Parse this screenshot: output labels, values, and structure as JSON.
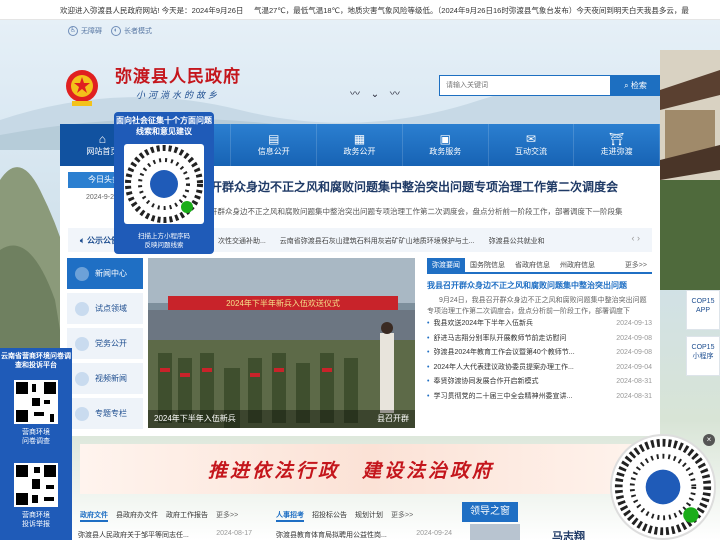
{
  "topbar": {
    "welcome": "欢迎进入弥渡县人民政府网站! 今天是：2024年9月26日",
    "ticker": "气温27℃，最低气温18℃，地质灾害气象风险等级低。（2024年9月26日16时弥渡县气象台发布）今天夜间到明天白天我县多云，最"
  },
  "accessibility": {
    "barrier_free": "无障碍",
    "elder_mode": "长者模式"
  },
  "header": {
    "site_title": "弥渡县人民政府",
    "slogan": "小河淌水的故乡",
    "search_placeholder": "请输入关键词",
    "search_button": "检索"
  },
  "nav": [
    {
      "label": "网站首页",
      "icon": "home-icon"
    },
    {
      "label": "",
      "icon": "info-icon"
    },
    {
      "label": "信息公开",
      "icon": "document-icon"
    },
    {
      "label": "政务公开",
      "icon": "government-icon"
    },
    {
      "label": "政务服务",
      "icon": "service-icon"
    },
    {
      "label": "互动交流",
      "icon": "chat-icon"
    },
    {
      "label": "走进弥渡",
      "icon": "landmark-icon"
    }
  ],
  "today": {
    "tab_label": "今日头条",
    "date": "2024-9-2"
  },
  "headline": {
    "title": "开群众身边不正之风和腐败问题集中整治突出问题专项治理工作第二次调度会",
    "summary": "开群众身边不正之风和腐败问题集中整治突出问题专项治理工作第二次调度会，盘点分析前一阶段工作，部署调度下一阶段集"
  },
  "notice": {
    "label": "公示公告",
    "items": [
      "次性交通补助...",
      "云南省弥渡县石灰山建筑石料用灰岩矿矿山地质环境保护与土...",
      "弥渡县公共就业和"
    ]
  },
  "left_menu": [
    {
      "label": "新闻中心",
      "active": true
    },
    {
      "label": "试点领域",
      "active": false
    },
    {
      "label": "党务公开",
      "active": false
    },
    {
      "label": "视频新闻",
      "active": false
    },
    {
      "label": "专题专栏",
      "active": false
    }
  ],
  "photo": {
    "banner_text": "2024年下半年新兵入伍欢送仪式",
    "caption": "2024年下半年入伍新兵",
    "caption_right": "县召开群"
  },
  "news": {
    "tabs": [
      "弥渡要闻",
      "国务院信息",
      "省政府信息",
      "州政府信息",
      "更多>>"
    ],
    "lead_title": "我县召开群众身边不正之风和腐败问题集中整治突出问题",
    "lead_summary": "9月24日，我县召开群众身边不正之风和腐败问题集中整治突出问题专项治理工作第二次调度会，盘点分析前一阶段工作，部署调度下",
    "items": [
      {
        "title": "我县欢送2024年下半年入伍新兵",
        "date": "2024-09-13"
      },
      {
        "title": "舒进马志翔分别率队开展教师节前走访慰问",
        "date": "2024-09-08"
      },
      {
        "title": "弥渡县2024年教育工作会议暨第40个教师节...",
        "date": "2024-09-08"
      },
      {
        "title": "2024年人大代表建议政协委员提案办理工作...",
        "date": "2024-09-04"
      },
      {
        "title": "奉贤弥渡协同发展合作开启新模式",
        "date": "2024-08-31"
      },
      {
        "title": "学习贯彻党的二十届三中全会精神州委宣讲...",
        "date": "2024-08-31"
      }
    ]
  },
  "banner": {
    "text": "推进依法行政　建设法治政府"
  },
  "bottom": {
    "gov_tabs": [
      "政府文件",
      "县政府办文件",
      "政府工作报告",
      "更多>>"
    ],
    "gov_item": {
      "title": "弥渡县人民政府关于邹平等同志任...",
      "date": "2024-08-17"
    },
    "hr_tabs": [
      "人事招考",
      "招投标公告",
      "规划计划",
      "更多>>"
    ],
    "hr_item": {
      "title": "弥渡县教育体育局拟聘用公益性岗...",
      "date": "2024-09-24"
    },
    "leader_tab": "领导之窗",
    "leader_name": "马志翔"
  },
  "popup": {
    "title": "面向社会征集十个方面问题线索和意见建议",
    "caption": "扫描上方小程序码\n反映问题线索"
  },
  "left_panel": {
    "title": "云南省营商环境问卷调查和投诉平台",
    "qr1_caption": "营商环境\n问卷调查",
    "qr2_caption": "营商环境\n投诉举报"
  },
  "cop15": [
    {
      "label": "COP15\nAPP"
    },
    {
      "label": "COP15\n小程序"
    }
  ],
  "colors": {
    "primary": "#1f6fc4",
    "red": "#c4161c",
    "nav": "#2b7fd0"
  }
}
